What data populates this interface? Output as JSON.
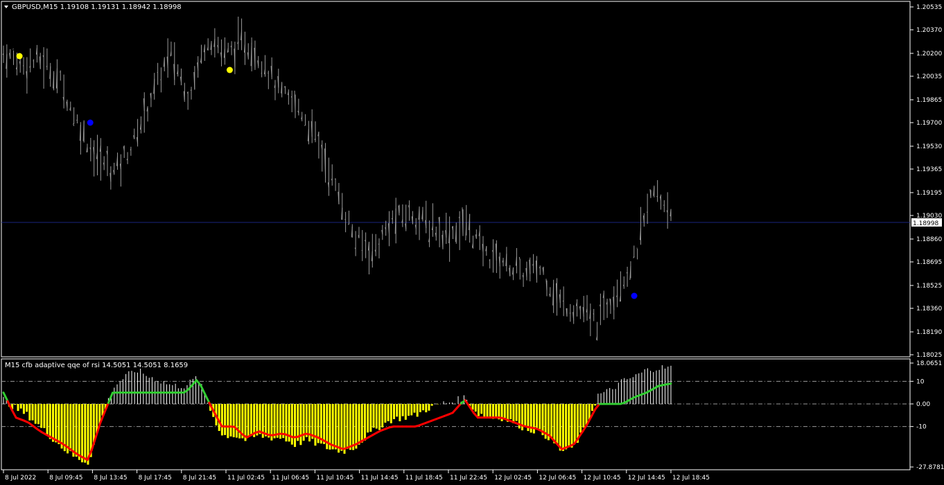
{
  "main_title": "GBPUSD,M15  1.19108 1.19131 1.18942 1.18998",
  "indicator_title": "M15  cfb adaptive qqe of rsi 14.5051 14.5051 8.1659",
  "price_badge": "1.18998",
  "colors": {
    "background": "#000000",
    "grid_border": "#ffffff",
    "candle": "#9a9a9a",
    "up_arrow": "#ffff00",
    "down_arrow": "#0000ff",
    "histogram_positive": "#ffffff",
    "histogram_negative": "#ffff00",
    "line_up": "#32cd32",
    "line_down": "#ff0000"
  },
  "chart_data": [
    {
      "type": "line",
      "title": "GBPUSD,M15",
      "ylim": [
        1.18025,
        1.20535
      ],
      "y_ticks": [
        "1.20535",
        "1.20370",
        "1.20200",
        "1.20035",
        "1.19865",
        "1.19700",
        "1.19530",
        "1.19365",
        "1.19195",
        "1.19030",
        "1.18860",
        "1.18695",
        "1.18525",
        "1.18360",
        "1.18190",
        "1.18025"
      ],
      "x_ticks": [
        "8 Jul 2022",
        "8 Jul 09:45",
        "8 Jul 13:45",
        "8 Jul 17:45",
        "8 Jul 21:45",
        "11 Jul 02:45",
        "11 Jul 06:45",
        "11 Jul 10:45",
        "11 Jul 14:45",
        "11 Jul 18:45",
        "11 Jul 22:45",
        "12 Jul 02:45",
        "12 Jul 06:45",
        "12 Jul 10:45",
        "12 Jul 14:45",
        "12 Jul 18:45"
      ],
      "last_price": 1.18998,
      "close_path": [
        1.202,
        1.2012,
        1.2015,
        1.2002,
        1.197,
        1.1945,
        1.1935,
        1.1955,
        1.199,
        1.202,
        1.199,
        1.2032,
        1.202,
        1.2028,
        1.2015,
        1.199,
        1.198,
        1.1955,
        1.192,
        1.1885,
        1.1878,
        1.19,
        1.1905,
        1.1895,
        1.189,
        1.1897,
        1.1875,
        1.187,
        1.186,
        1.1865,
        1.184,
        1.1835,
        1.1825,
        1.185,
        1.187,
        1.192,
        1.1908
      ],
      "up_signals": [
        1.2018,
        1.2008
      ],
      "down_signals": [
        1.197,
        1.1845
      ]
    },
    {
      "type": "line",
      "title": "cfb adaptive qqe of rsi",
      "ylim": [
        -27.8781,
        18.0651
      ],
      "y_ticks": [
        "18.0651",
        "10",
        "0.00",
        "-10",
        "-27.8781"
      ],
      "line_path": [
        5,
        -6,
        -8,
        -12,
        -15,
        -18,
        -22,
        -25,
        -8,
        5,
        5,
        5,
        5,
        5,
        5,
        5,
        11,
        0,
        -10,
        -10,
        -15,
        -12,
        -14,
        -13,
        -15,
        -13,
        -15,
        -18,
        -20,
        -18,
        -15,
        -12,
        -10,
        -10,
        -10,
        -8,
        -6,
        -4,
        2,
        -6,
        -6,
        -6,
        -8,
        -10,
        -11,
        -14,
        -20,
        -18,
        -10,
        0,
        0,
        0,
        3,
        5,
        8,
        9
      ],
      "histogram_bars": [
        2,
        -2,
        -5,
        -10,
        -15,
        -20,
        -24,
        -26,
        -8,
        7,
        12,
        15,
        12,
        10,
        8,
        8,
        12,
        -2,
        -14,
        -14,
        -16,
        -14,
        -15,
        -15,
        -18,
        -16,
        -18,
        -20,
        -21,
        -19,
        -14,
        -10,
        -7,
        -6,
        -5,
        -2,
        0,
        1,
        3,
        -4,
        -6,
        -6,
        -8,
        -11,
        -12,
        -15,
        -21,
        -19,
        -10,
        4,
        6,
        10,
        12,
        15,
        16,
        16
      ]
    }
  ]
}
